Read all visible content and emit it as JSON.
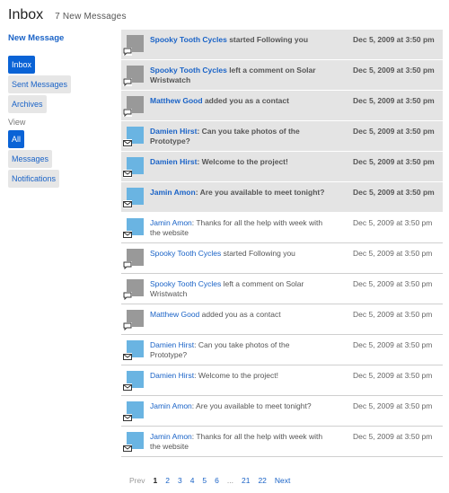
{
  "header": {
    "title": "Inbox",
    "count_text": "7 New Messages"
  },
  "sidebar": {
    "new_message": "New Message",
    "folders": [
      {
        "label": "Inbox",
        "active": true
      },
      {
        "label": "Sent Messages",
        "active": false
      },
      {
        "label": "Archives",
        "active": false
      }
    ],
    "view_label": "View",
    "views": [
      {
        "label": "All",
        "active": true
      },
      {
        "label": "Messages",
        "active": false
      },
      {
        "label": "Notifications",
        "active": false
      }
    ]
  },
  "messages": [
    {
      "unread": true,
      "thumb": "gray",
      "icon": "speech-bubble-icon",
      "who": "Spooky Tooth Cycles",
      "sep": " ",
      "text": "started Following you",
      "date": "Dec 5, 2009 at 3:50 pm"
    },
    {
      "unread": true,
      "thumb": "gray",
      "icon": "speech-bubble-icon",
      "who": "Spooky Tooth Cycles",
      "sep": " ",
      "text": "left a comment on Solar Wristwatch",
      "date": "Dec 5, 2009 at 3:50 pm"
    },
    {
      "unread": true,
      "thumb": "gray",
      "icon": "speech-bubble-icon",
      "who": "Matthew Good",
      "sep": " ",
      "text": "added you as a contact",
      "date": "Dec 5, 2009 at 3:50 pm"
    },
    {
      "unread": true,
      "thumb": "blue",
      "icon": "envelope-icon",
      "who": "Damien Hirst",
      "sep": ": ",
      "text": "Can you take photos of the Prototype?",
      "date": "Dec 5, 2009 at 3:50 pm"
    },
    {
      "unread": true,
      "thumb": "blue",
      "icon": "envelope-icon",
      "who": "Damien Hirst",
      "sep": ": ",
      "text": "Welcome to the project!",
      "date": "Dec 5, 2009 at 3:50 pm"
    },
    {
      "unread": true,
      "thumb": "blue",
      "icon": "envelope-icon",
      "who": "Jamin Amon",
      "sep": ": ",
      "text": "Are you available to meet tonight?",
      "date": "Dec 5, 2009 at 3:50 pm"
    },
    {
      "unread": false,
      "thumb": "blue",
      "icon": "envelope-icon",
      "who": "Jamin Amon",
      "sep": ": ",
      "text": "Thanks for all the help with week with the website",
      "date": "Dec 5, 2009 at 3:50 pm"
    },
    {
      "unread": false,
      "thumb": "gray",
      "icon": "speech-bubble-icon",
      "who": "Spooky Tooth Cycles",
      "sep": " ",
      "text": "started Following you",
      "date": "Dec 5, 2009 at 3:50 pm"
    },
    {
      "unread": false,
      "thumb": "gray",
      "icon": "speech-bubble-icon",
      "who": "Spooky Tooth Cycles",
      "sep": " ",
      "text": "left a comment on Solar Wristwatch",
      "date": "Dec 5, 2009 at 3:50 pm"
    },
    {
      "unread": false,
      "thumb": "gray",
      "icon": "speech-bubble-icon",
      "who": "Matthew Good",
      "sep": " ",
      "text": "added you as a contact",
      "date": "Dec 5, 2009 at 3:50 pm"
    },
    {
      "unread": false,
      "thumb": "blue",
      "icon": "envelope-icon",
      "who": "Damien Hirst",
      "sep": ": ",
      "text": "Can you take photos of the Prototype?",
      "date": "Dec 5, 2009 at 3:50 pm"
    },
    {
      "unread": false,
      "thumb": "blue",
      "icon": "envelope-icon",
      "who": "Damien Hirst",
      "sep": ": ",
      "text": "Welcome to the project!",
      "date": "Dec 5, 2009 at 3:50 pm"
    },
    {
      "unread": false,
      "thumb": "blue",
      "icon": "envelope-icon",
      "who": "Jamin Amon",
      "sep": ": ",
      "text": "Are you available to meet tonight?",
      "date": "Dec 5, 2009 at 3:50 pm"
    },
    {
      "unread": false,
      "thumb": "blue",
      "icon": "envelope-icon",
      "who": "Jamin Amon",
      "sep": ": ",
      "text": "Thanks for all the help with week with the website",
      "date": "Dec 5, 2009 at 3:50 pm"
    }
  ],
  "pagination": {
    "prev": "Prev",
    "pages": [
      "1",
      "2",
      "3",
      "4",
      "5",
      "6",
      "...",
      "21",
      "22"
    ],
    "current": "1",
    "next": "Next"
  },
  "colors": {
    "accent": "#0a63d6",
    "link": "#1a63c7",
    "unread_bg": "#e4e4e4",
    "thumb_gray": "#999999",
    "thumb_blue": "#6ab4e2"
  }
}
